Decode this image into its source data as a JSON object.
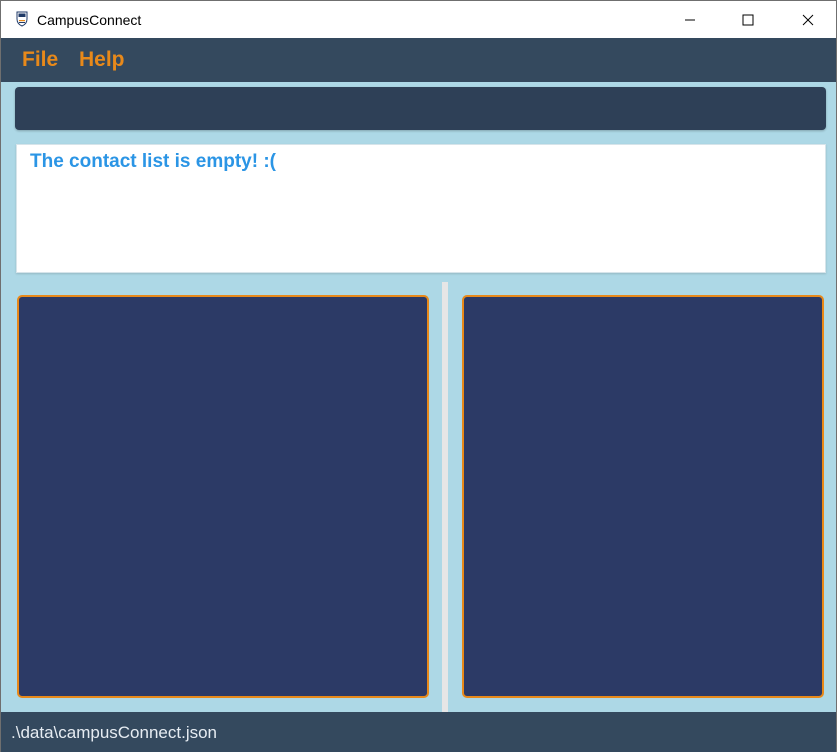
{
  "window": {
    "title": "CampusConnect",
    "icon": "nus-logo-icon",
    "controls": [
      "minimize-icon",
      "maximize-icon",
      "close-icon"
    ]
  },
  "menu": {
    "file_label": "File",
    "help_label": "Help"
  },
  "command_box": {
    "value": "",
    "placeholder": ""
  },
  "result_display": {
    "message": "The contact list is empty! :("
  },
  "status_bar": {
    "file_path": ".\\data\\campusConnect.json"
  },
  "colors": {
    "menu_text": "#e8891a",
    "background": "#add8e6",
    "menu_background": "#34495e",
    "panel_fill": "#2c3a66",
    "panel_border": "#e8891a",
    "result_text": "#2b95e5"
  }
}
